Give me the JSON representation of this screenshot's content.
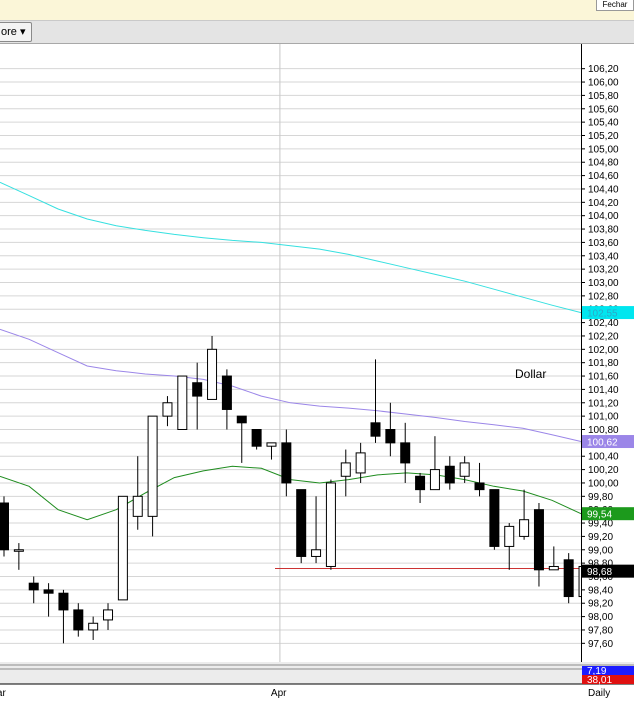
{
  "toolbar": {
    "more_label": "ore ▾",
    "top_tab": "Fechar"
  },
  "chart_data": {
    "type": "candlestick",
    "instrument_label": "Dollar",
    "period_label": "Daily",
    "x_labels": [
      {
        "index": 0,
        "label": "Mar"
      },
      {
        "index": 19,
        "label": "Apr"
      }
    ],
    "ylim": [
      97.5,
      106.3
    ],
    "y_ticks": [
      106.2,
      106.0,
      105.8,
      105.6,
      105.4,
      105.2,
      105.0,
      104.8,
      104.6,
      104.4,
      104.2,
      104.0,
      103.8,
      103.6,
      103.4,
      103.2,
      103.0,
      102.8,
      102.6,
      102.4,
      102.2,
      102.0,
      101.8,
      101.6,
      101.4,
      101.2,
      101.0,
      100.8,
      100.6,
      100.4,
      100.2,
      100.0,
      99.8,
      99.6,
      99.4,
      99.2,
      99.0,
      98.8,
      98.6,
      98.4,
      98.2,
      98.0,
      97.8,
      97.6
    ],
    "candles": [
      {
        "o": 99.7,
        "h": 99.8,
        "l": 98.9,
        "c": 99.0
      },
      {
        "o": 99.0,
        "h": 99.1,
        "l": 98.7,
        "c": 99.0
      },
      {
        "o": 98.5,
        "h": 98.6,
        "l": 98.2,
        "c": 98.4
      },
      {
        "o": 98.4,
        "h": 98.5,
        "l": 98.0,
        "c": 98.35
      },
      {
        "o": 98.35,
        "h": 98.4,
        "l": 97.6,
        "c": 98.1
      },
      {
        "o": 98.1,
        "h": 98.2,
        "l": 97.7,
        "c": 97.8
      },
      {
        "o": 97.8,
        "h": 98.0,
        "l": 97.65,
        "c": 97.9
      },
      {
        "o": 97.95,
        "h": 98.2,
        "l": 97.8,
        "c": 98.1
      },
      {
        "o": 98.25,
        "h": 99.8,
        "l": 98.25,
        "c": 99.8
      },
      {
        "o": 99.5,
        "h": 100.4,
        "l": 99.3,
        "c": 99.8
      },
      {
        "o": 99.5,
        "h": 101.0,
        "l": 99.2,
        "c": 101.0
      },
      {
        "o": 101.0,
        "h": 101.3,
        "l": 100.85,
        "c": 101.2
      },
      {
        "o": 100.8,
        "h": 101.6,
        "l": 100.8,
        "c": 101.6
      },
      {
        "o": 101.5,
        "h": 101.8,
        "l": 100.8,
        "c": 101.3
      },
      {
        "o": 101.25,
        "h": 102.2,
        "l": 101.25,
        "c": 102.0
      },
      {
        "o": 101.6,
        "h": 101.7,
        "l": 100.8,
        "c": 101.1
      },
      {
        "o": 101.0,
        "h": 101.0,
        "l": 100.3,
        "c": 100.9
      },
      {
        "o": 100.8,
        "h": 100.8,
        "l": 100.5,
        "c": 100.55
      },
      {
        "o": 100.55,
        "h": 100.6,
        "l": 100.35,
        "c": 100.6
      },
      {
        "o": 100.6,
        "h": 100.8,
        "l": 99.8,
        "c": 100.0
      },
      {
        "o": 99.9,
        "h": 99.9,
        "l": 98.8,
        "c": 98.9
      },
      {
        "o": 98.9,
        "h": 99.8,
        "l": 98.8,
        "c": 99.0
      },
      {
        "o": 98.75,
        "h": 100.05,
        "l": 98.7,
        "c": 100.0
      },
      {
        "o": 100.1,
        "h": 100.5,
        "l": 99.8,
        "c": 100.3
      },
      {
        "o": 100.15,
        "h": 100.6,
        "l": 100.0,
        "c": 100.45
      },
      {
        "o": 100.9,
        "h": 101.85,
        "l": 100.6,
        "c": 100.7
      },
      {
        "o": 100.8,
        "h": 101.2,
        "l": 100.4,
        "c": 100.6
      },
      {
        "o": 100.6,
        "h": 100.9,
        "l": 100.0,
        "c": 100.3
      },
      {
        "o": 100.1,
        "h": 100.15,
        "l": 99.7,
        "c": 99.9
      },
      {
        "o": 99.9,
        "h": 100.7,
        "l": 99.9,
        "c": 100.2
      },
      {
        "o": 100.25,
        "h": 100.4,
        "l": 99.9,
        "c": 100.0
      },
      {
        "o": 100.1,
        "h": 100.4,
        "l": 100.0,
        "c": 100.3
      },
      {
        "o": 100.0,
        "h": 100.3,
        "l": 99.8,
        "c": 99.9
      },
      {
        "o": 99.9,
        "h": 99.9,
        "l": 99.0,
        "c": 99.05
      },
      {
        "o": 99.05,
        "h": 99.4,
        "l": 98.7,
        "c": 99.35
      },
      {
        "o": 99.2,
        "h": 99.9,
        "l": 99.15,
        "c": 99.45
      },
      {
        "o": 99.6,
        "h": 99.7,
        "l": 98.45,
        "c": 98.7
      },
      {
        "o": 98.7,
        "h": 99.05,
        "l": 98.7,
        "c": 98.75
      },
      {
        "o": 98.85,
        "h": 98.95,
        "l": 98.2,
        "c": 98.3
      },
      {
        "o": 98.3,
        "h": 98.75,
        "l": 98.25,
        "c": 98.75
      }
    ],
    "series": [
      {
        "color": "#36e0e0",
        "type": "line",
        "values": [
          104.5,
          104.3,
          104.1,
          103.95,
          103.85,
          103.78,
          103.72,
          103.67,
          103.63,
          103.6,
          103.55,
          103.5,
          103.42,
          103.32,
          103.22,
          103.12,
          103.02,
          102.9,
          102.78,
          102.66,
          102.55
        ]
      },
      {
        "color": "#9b86e8",
        "type": "line",
        "values": [
          102.3,
          102.15,
          101.95,
          101.75,
          101.68,
          101.63,
          101.6,
          101.55,
          101.45,
          101.3,
          101.2,
          101.15,
          101.12,
          101.08,
          101.03,
          100.98,
          100.92,
          100.87,
          100.82,
          100.72,
          100.62
        ]
      },
      {
        "color": "#1f8c1f",
        "type": "line",
        "values": [
          100.1,
          99.95,
          99.6,
          99.45,
          99.6,
          99.85,
          100.08,
          100.18,
          100.25,
          100.22,
          100.05,
          100.0,
          100.05,
          100.12,
          100.15,
          100.12,
          100.05,
          99.95,
          99.88,
          99.74,
          99.54
        ]
      }
    ],
    "hline": {
      "value": 98.72,
      "color": "#cc3333"
    },
    "value_tags": [
      {
        "label": "102,55",
        "bg": "#00e6ef",
        "fg": "#2aa8c8"
      },
      {
        "label": "100,62",
        "bg": "#9b86e8",
        "fg": "#ffffff"
      },
      {
        "label": "99,54",
        "bg": "#1c9a1c",
        "fg": "#ffffff"
      },
      {
        "label": "98,68",
        "bg": "#000000",
        "fg": "#ffffff"
      }
    ],
    "bottom_tags": [
      {
        "label": "7,19",
        "bg": "#1c1cff",
        "fg": "#ffffff"
      },
      {
        "label": "38,01",
        "bg": "#e01010",
        "fg": "#ffffff"
      }
    ]
  }
}
